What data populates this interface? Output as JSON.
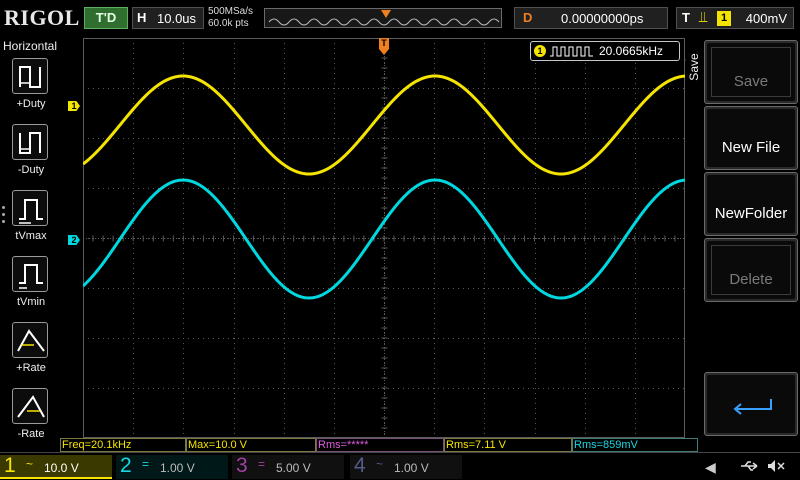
{
  "topbar": {
    "logo": "RIGOL",
    "run_status": "T'D",
    "timebase_label": "H",
    "timebase_value": "10.0us",
    "sample_rate": "500MSa/s",
    "memory_depth": "60.0k pts",
    "delay_label": "D",
    "delay_value": "0.00000000ps",
    "trigger_label": "T",
    "trigger_source": "1",
    "trigger_level": "400mV"
  },
  "left_panel": {
    "title": "Horizontal",
    "items": [
      {
        "label": "+Duty",
        "icon": "positive-duty-icon"
      },
      {
        "label": "-Duty",
        "icon": "negative-duty-icon"
      },
      {
        "label": "tVmax",
        "icon": "tvmax-icon"
      },
      {
        "label": "tVmin",
        "icon": "tvmin-icon"
      },
      {
        "label": "+Rate",
        "icon": "positive-rate-icon"
      },
      {
        "label": "-Rate",
        "icon": "negative-rate-icon"
      }
    ]
  },
  "screen": {
    "ch1_marker": "1",
    "ch2_marker": "2",
    "trigger_marker": "T",
    "freq_counter": {
      "source": "1",
      "value": "20.0665kHz"
    },
    "colors": {
      "ch1": "#f5e400",
      "ch2": "#00d8e0",
      "grid": "#5a5a5a",
      "trigger": "#f07f20"
    }
  },
  "right_menu": {
    "title": "Save",
    "keys": [
      {
        "label": "Save",
        "enabled": false
      },
      {
        "label": "New File",
        "enabled": true
      },
      {
        "label": "NewFolder",
        "enabled": true
      },
      {
        "label": "Delete",
        "enabled": false
      }
    ],
    "back_icon": "return-arrow-icon"
  },
  "measurements": [
    {
      "text": "Freq=20.1kHz",
      "color": "yellow"
    },
    {
      "text": "Max=10.0 V",
      "color": "yellow"
    },
    {
      "text": "Rms=*****",
      "color": "magenta"
    },
    {
      "text": "Rms=7.11 V",
      "color": "yellow"
    },
    {
      "text": "Rms=859mV",
      "color": "cyan"
    }
  ],
  "channels": [
    {
      "num": "1",
      "coupling": "~",
      "scale": "10.0 V"
    },
    {
      "num": "2",
      "coupling": "=",
      "scale": "1.00 V"
    },
    {
      "num": "3",
      "coupling": "=",
      "scale": "5.00 V"
    },
    {
      "num": "4",
      "coupling": "~",
      "scale": "1.00 V"
    }
  ],
  "status_icons": [
    "nav-left-arrow-icon",
    "usb-icon",
    "sound-muted-icon"
  ]
}
